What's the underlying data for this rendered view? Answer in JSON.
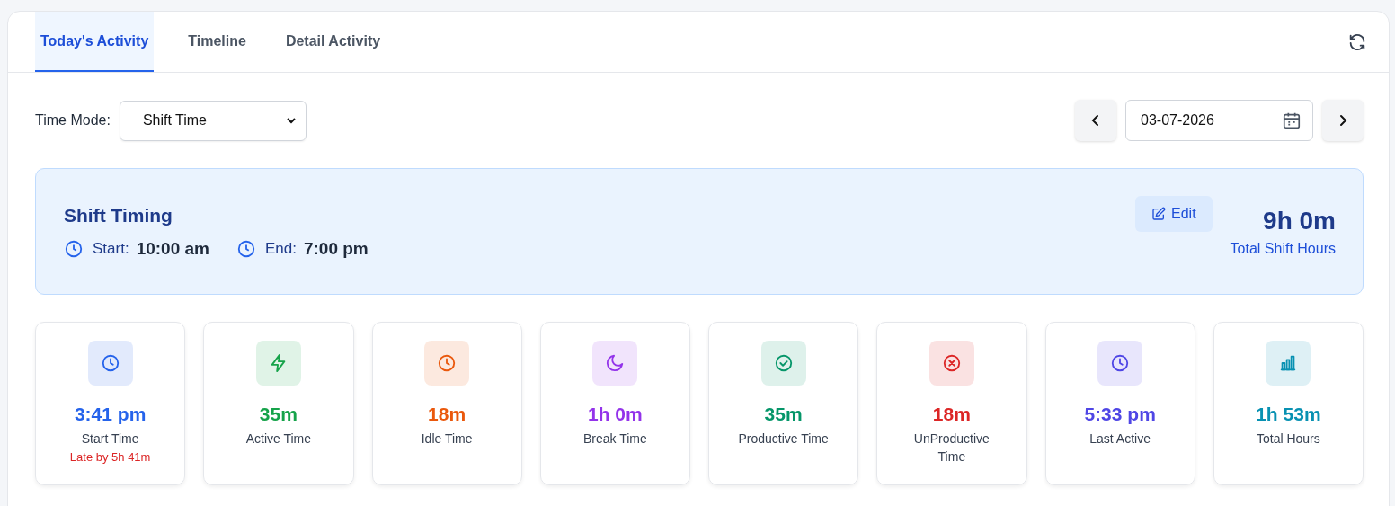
{
  "tabs": [
    {
      "label": "Today's Activity",
      "selected": true
    },
    {
      "label": "Timeline",
      "selected": false
    },
    {
      "label": "Detail Activity",
      "selected": false
    }
  ],
  "filters": {
    "time_mode_label": "Time Mode:",
    "time_mode_value": "Shift Time",
    "date": "03-07-2026"
  },
  "shift": {
    "title": "Shift Timing",
    "start_label": "Start:",
    "start_value": "10:00 am",
    "end_label": "End:",
    "end_value": "7:00 pm",
    "edit_button": "Edit",
    "total_value": "9h 0m",
    "total_label": "Total Shift Hours"
  },
  "stats": [
    {
      "kind": "clock",
      "color": "#2563eb",
      "value": "3:41 pm",
      "label": "Start Time",
      "note": "Late by 5h 41m"
    },
    {
      "kind": "bolt",
      "color": "#16a34a",
      "value": "35m",
      "label": "Active Time"
    },
    {
      "kind": "clock",
      "color": "#ea580c",
      "value": "18m",
      "label": "Idle Time"
    },
    {
      "kind": "moon",
      "color": "#9333ea",
      "value": "1h 0m",
      "label": "Break Time"
    },
    {
      "kind": "check",
      "color": "#059669",
      "value": "35m",
      "label": "Productive Time"
    },
    {
      "kind": "cross",
      "color": "#dc2626",
      "value": "18m",
      "label": "UnProductive Time"
    },
    {
      "kind": "clock",
      "color": "#4f46e5",
      "value": "5:33 pm",
      "label": "Last Active"
    },
    {
      "kind": "chart",
      "color": "#0891b2",
      "value": "1h 53m",
      "label": "Total Hours"
    }
  ]
}
